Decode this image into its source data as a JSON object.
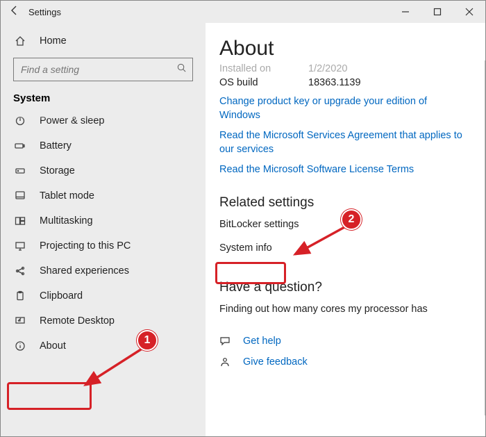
{
  "window": {
    "title": "Settings"
  },
  "sidebar": {
    "home": "Home",
    "search_placeholder": "Find a setting",
    "category": "System",
    "items": [
      {
        "label": "Power & sleep"
      },
      {
        "label": "Battery"
      },
      {
        "label": "Storage"
      },
      {
        "label": "Tablet mode"
      },
      {
        "label": "Multitasking"
      },
      {
        "label": "Projecting to this PC"
      },
      {
        "label": "Shared experiences"
      },
      {
        "label": "Clipboard"
      },
      {
        "label": "Remote Desktop"
      },
      {
        "label": "About"
      }
    ]
  },
  "content": {
    "heading": "About",
    "installed_on_label": "Installed on",
    "installed_on_value": "1/2/2020",
    "os_build_label": "OS build",
    "os_build_value": "18363.1139",
    "change_key": "Change product key or upgrade your edition of Windows",
    "msa": "Read the Microsoft Services Agreement that applies to our services",
    "license": "Read the Microsoft Software License Terms",
    "related_heading": "Related settings",
    "bitlocker": "BitLocker settings",
    "system_info": "System info",
    "question_heading": "Have a question?",
    "cores": "Finding out how many cores my processor has",
    "get_help": "Get help",
    "feedback": "Give feedback"
  },
  "annotations": {
    "badge1": "1",
    "badge2": "2"
  }
}
